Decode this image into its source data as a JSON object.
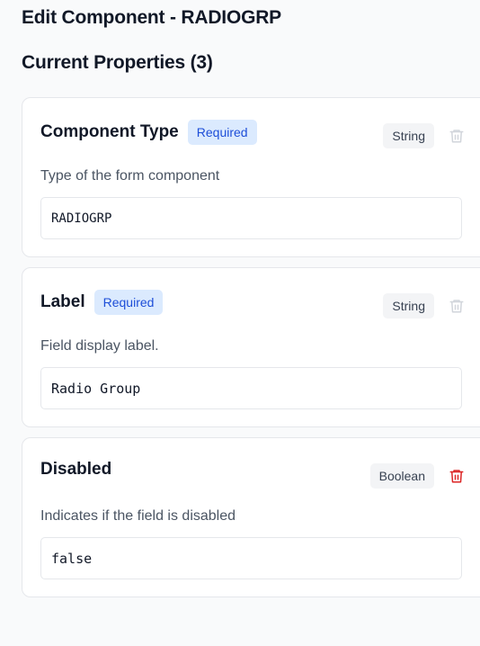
{
  "header": {
    "title": "Edit Component - RADIOGRP",
    "section_title": "Current Properties (3)"
  },
  "properties": [
    {
      "name": "Component Type",
      "required_label": "Required",
      "type": "String",
      "description": "Type of the form component",
      "value": "RADIOGRP",
      "delete_icon": "trash-icon",
      "delete_enabled": false
    },
    {
      "name": "Label",
      "required_label": "Required",
      "type": "String",
      "description": "Field display label.",
      "value": "Radio Group",
      "delete_icon": "trash-icon",
      "delete_enabled": false
    },
    {
      "name": "Disabled",
      "type": "Boolean",
      "description": "Indicates if the field is disabled",
      "value": "false",
      "delete_icon": "trash-icon",
      "delete_enabled": true
    }
  ],
  "colors": {
    "required_badge_bg": "#dbeafe",
    "required_badge_text": "#1d4ed8",
    "trash_disabled": "#d1d5db",
    "trash_enabled": "#dc2626"
  }
}
